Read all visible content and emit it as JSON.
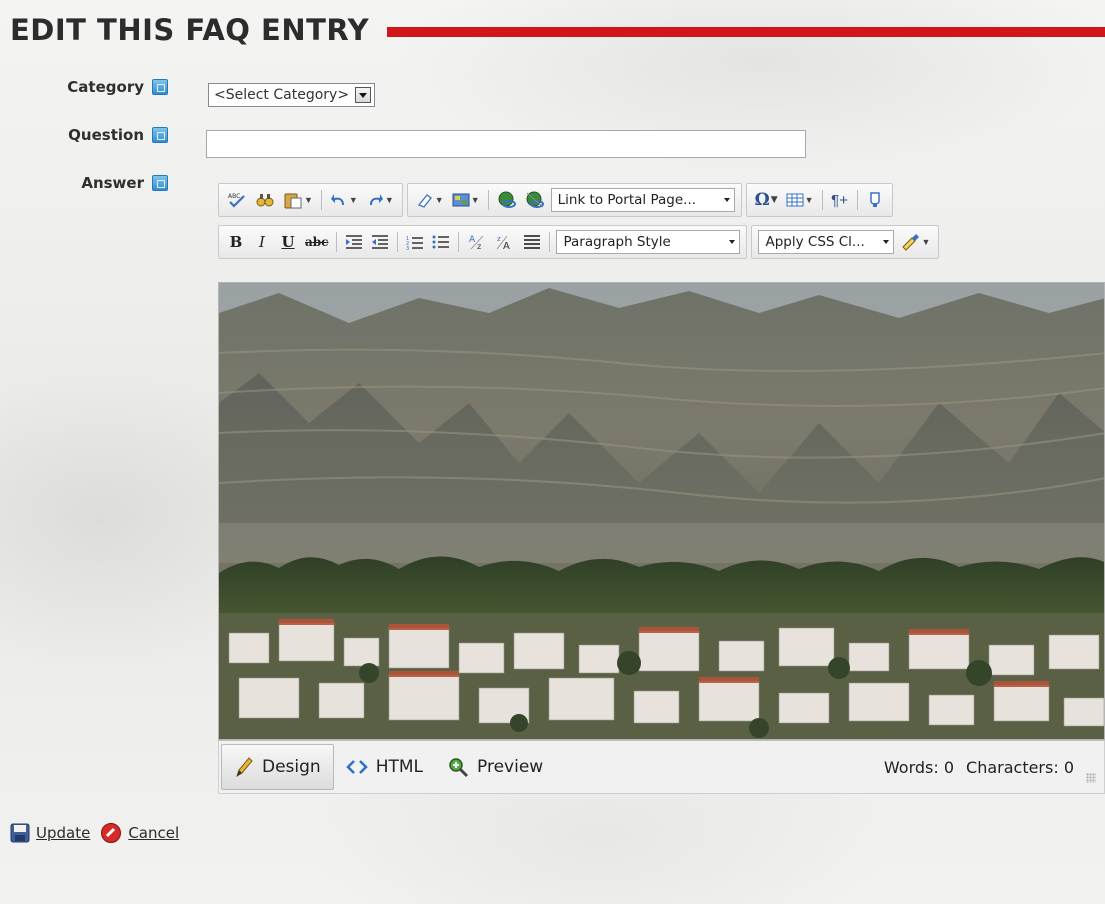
{
  "header": {
    "title": "EDIT THIS FAQ ENTRY"
  },
  "form": {
    "category_label": "Category",
    "category_value": "<Select Category>",
    "question_label": "Question",
    "question_value": "",
    "answer_label": "Answer"
  },
  "toolbar": {
    "link_dropdown": "Link to Portal Page...",
    "paragraph_dropdown": "Paragraph Style",
    "css_dropdown": "Apply CSS Cl...",
    "bold": "B",
    "italic": "I",
    "underline": "U",
    "strike": "abc"
  },
  "editor_modes": {
    "design": "Design",
    "html": "HTML",
    "preview": "Preview"
  },
  "status": {
    "words": "Words: 0",
    "characters": "Characters: 0"
  },
  "actions": {
    "update": "Update",
    "cancel": "Cancel"
  },
  "colors": {
    "title_rule": "#d0151b",
    "help_icon": "#2f8fd0"
  }
}
